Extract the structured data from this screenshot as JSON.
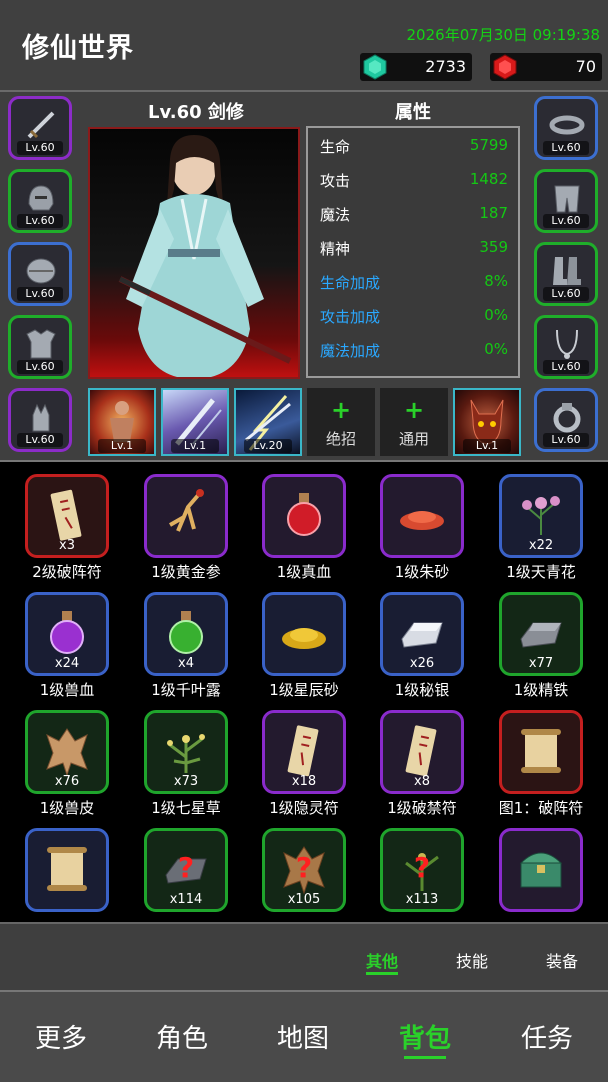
{
  "header": {
    "title": "修仙世界",
    "datetime": "2026年07月30日 09:19:38",
    "jade_amount": "2733",
    "ruby_amount": "70",
    "jade_color": "#1fc9a0",
    "ruby_color": "#d81a1a"
  },
  "character": {
    "name": "Lv.60 剑修",
    "attr_title": "属性",
    "attributes": [
      {
        "key": "生命",
        "value": "5799"
      },
      {
        "key": "攻击",
        "value": "1482"
      },
      {
        "key": "魔法",
        "value": "187"
      },
      {
        "key": "精神",
        "value": "359"
      },
      {
        "key": "生命加成",
        "value": "8%"
      },
      {
        "key": "攻击加成",
        "value": "0%"
      },
      {
        "key": "魔法加成",
        "value": "0%"
      }
    ],
    "left_equipment": [
      {
        "icon": "sword-icon",
        "level": "Lv.60"
      },
      {
        "icon": "helmet-icon",
        "level": "Lv.60"
      },
      {
        "icon": "pauldron-icon",
        "level": "Lv.60"
      },
      {
        "icon": "armor-icon",
        "level": "Lv.60"
      },
      {
        "icon": "gauntlet-icon",
        "level": "Lv.60"
      }
    ],
    "right_equipment": [
      {
        "icon": "belt-icon",
        "level": "Lv.60"
      },
      {
        "icon": "leg-armor-icon",
        "level": "Lv.60"
      },
      {
        "icon": "boots-icon",
        "level": "Lv.60"
      },
      {
        "icon": "necklace-icon",
        "level": "Lv.60"
      },
      {
        "icon": "ring-icon",
        "level": "Lv.60"
      }
    ],
    "skills": [
      {
        "icon": "monk-skill-icon",
        "level": "Lv.1"
      },
      {
        "icon": "sword-rain-skill-icon",
        "level": "Lv.1"
      },
      {
        "icon": "lightning-blade-skill-icon",
        "level": "Lv.20"
      }
    ],
    "empty_skills": [
      {
        "plus": "+",
        "label": "绝招"
      },
      {
        "plus": "+",
        "label": "通用"
      }
    ],
    "extra_skill": {
      "icon": "demon-skill-icon",
      "level": "Lv.1"
    }
  },
  "inventory": {
    "items": [
      {
        "name": "2级破阵符",
        "count": "x3",
        "rarity": "red",
        "icon": "talisman-icon"
      },
      {
        "name": "1级黄金参",
        "count": "",
        "rarity": "purple",
        "icon": "ginseng-icon"
      },
      {
        "name": "1级真血",
        "count": "",
        "rarity": "purple",
        "icon": "red-potion-icon"
      },
      {
        "name": "1级朱砂",
        "count": "",
        "rarity": "purple",
        "icon": "cinnabar-icon"
      },
      {
        "name": "1级天青花",
        "count": "x22",
        "rarity": "blue",
        "icon": "flower-icon"
      },
      {
        "name": "1级兽血",
        "count": "x24",
        "rarity": "blue",
        "icon": "purple-potion-icon"
      },
      {
        "name": "1级千叶露",
        "count": "x4",
        "rarity": "blue",
        "icon": "green-potion-icon"
      },
      {
        "name": "1级星辰砂",
        "count": "",
        "rarity": "blue",
        "icon": "gold-sand-icon"
      },
      {
        "name": "1级秘银",
        "count": "x26",
        "rarity": "blue",
        "icon": "silver-ingot-icon"
      },
      {
        "name": "1级精铁",
        "count": "x77",
        "rarity": "green",
        "icon": "iron-ingot-icon"
      },
      {
        "name": "1级兽皮",
        "count": "x76",
        "rarity": "green",
        "icon": "hide-icon"
      },
      {
        "name": "1级七星草",
        "count": "x73",
        "rarity": "green",
        "icon": "herb-icon"
      },
      {
        "name": "1级隐灵符",
        "count": "x18",
        "rarity": "purple",
        "icon": "talisman-icon"
      },
      {
        "name": "1级破禁符",
        "count": "x8",
        "rarity": "purple",
        "icon": "talisman-icon"
      },
      {
        "name": "图1：破阵符",
        "count": "",
        "rarity": "red",
        "icon": "scroll-icon"
      },
      {
        "name": "",
        "count": "",
        "rarity": "blue",
        "icon": "scroll-icon"
      },
      {
        "name": "",
        "count": "x114",
        "rarity": "green",
        "icon": "unknown-ore-icon"
      },
      {
        "name": "",
        "count": "x105",
        "rarity": "green",
        "icon": "unknown-hide-icon"
      },
      {
        "name": "",
        "count": "x113",
        "rarity": "green",
        "icon": "unknown-herb-icon"
      },
      {
        "name": "",
        "count": "",
        "rarity": "purple",
        "icon": "treasure-chest-icon"
      }
    ]
  },
  "subtabs": {
    "items": [
      {
        "label": "其他",
        "active": true
      },
      {
        "label": "技能",
        "active": false
      },
      {
        "label": "装备",
        "active": false
      }
    ]
  },
  "nav": {
    "items": [
      {
        "label": "更多",
        "active": false
      },
      {
        "label": "角色",
        "active": false
      },
      {
        "label": "地图",
        "active": false
      },
      {
        "label": "背包",
        "active": true
      },
      {
        "label": "任务",
        "active": false
      }
    ],
    "active_color": "#2ad12a"
  }
}
